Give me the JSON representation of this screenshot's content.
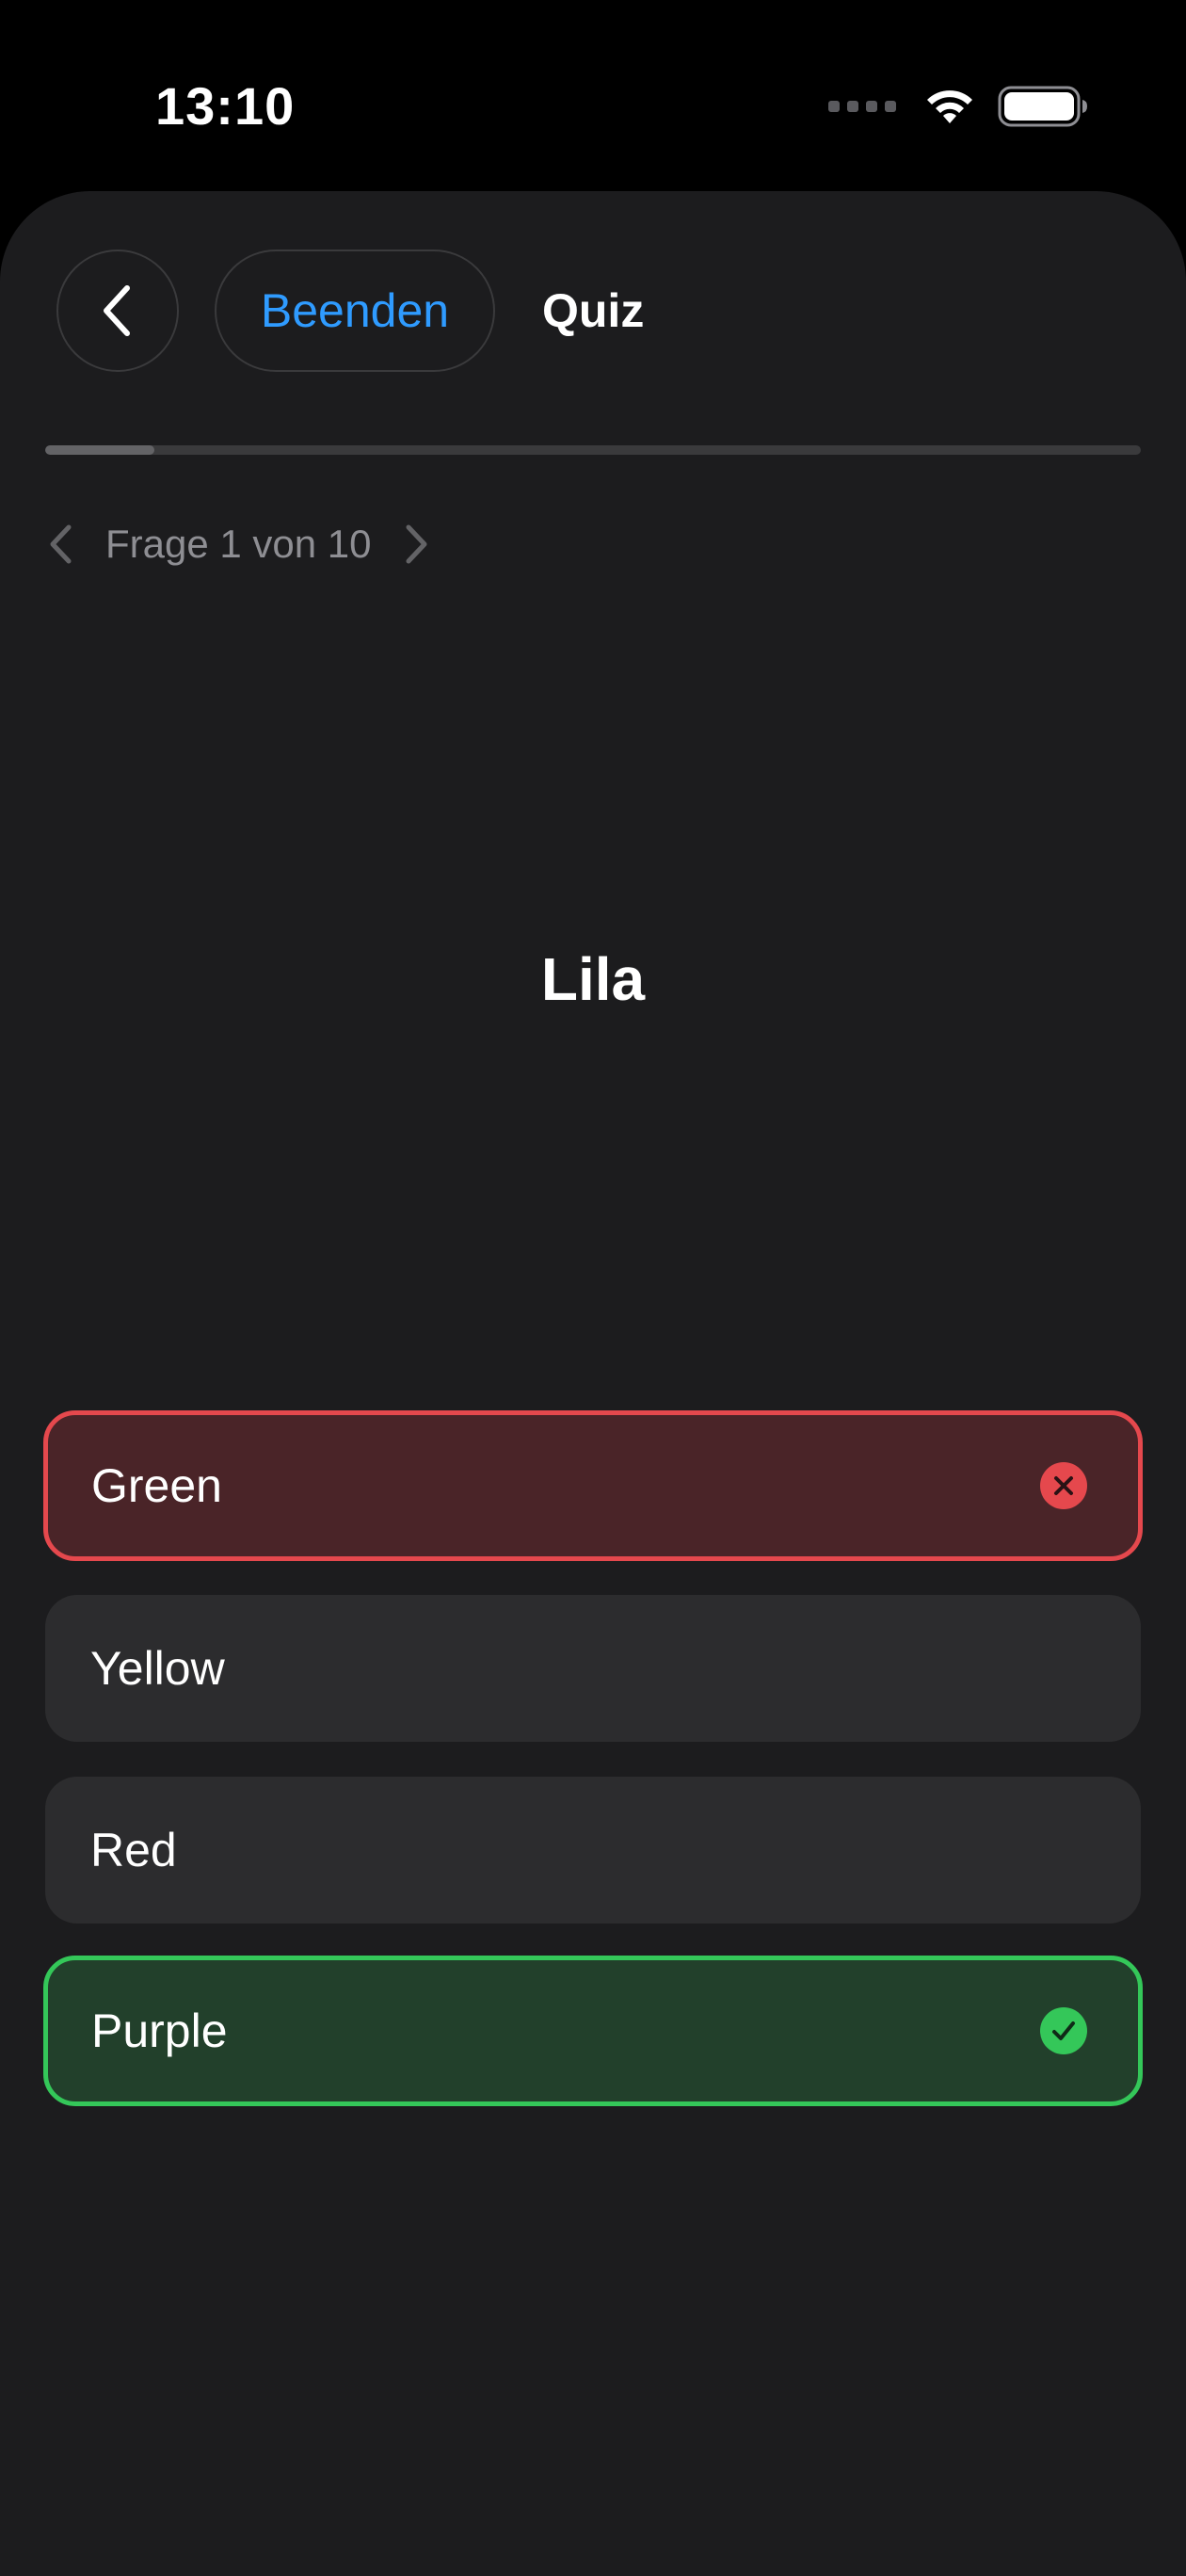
{
  "status_bar": {
    "time": "13:10"
  },
  "header": {
    "end_label": "Beenden",
    "title": "Quiz"
  },
  "progress": {
    "fraction": 0.1
  },
  "question_nav": {
    "counter": "Frage 1 von 10"
  },
  "question": {
    "word": "Lila"
  },
  "answers": [
    {
      "label": "Green",
      "state": "wrong"
    },
    {
      "label": "Yellow",
      "state": "neutral"
    },
    {
      "label": "Red",
      "state": "neutral"
    },
    {
      "label": "Purple",
      "state": "correct"
    }
  ],
  "colors": {
    "accent": "#2f9bff",
    "wrong": "#e5484d",
    "correct": "#34c759",
    "background": "#1c1c1e"
  },
  "icons": {
    "back": "chevron-left-icon",
    "prev": "chevron-left-icon",
    "next": "chevron-right-icon",
    "wrong": "xmark-circle-icon",
    "correct": "checkmark-circle-icon"
  }
}
